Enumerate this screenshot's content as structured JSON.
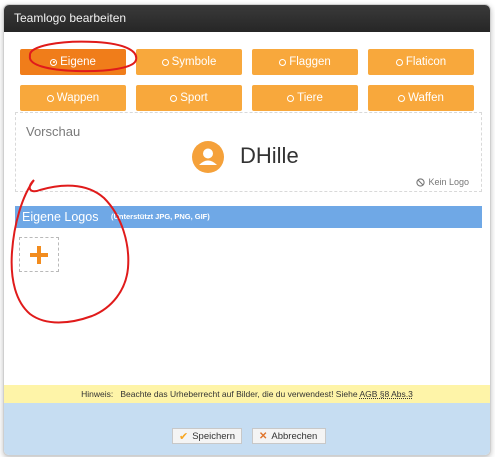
{
  "dialog": {
    "title": "Teamlogo bearbeiten"
  },
  "categories": [
    {
      "label": "Eigene",
      "selected": true
    },
    {
      "label": "Symbole",
      "selected": false
    },
    {
      "label": "Flaggen",
      "selected": false
    },
    {
      "label": "Flaticon",
      "selected": false
    },
    {
      "label": "Wappen",
      "selected": false
    },
    {
      "label": "Sport",
      "selected": false
    },
    {
      "label": "Tiere",
      "selected": false
    },
    {
      "label": "Waffen",
      "selected": false
    }
  ],
  "preview": {
    "label": "Vorschau",
    "team_name": "DHille",
    "no_logo_label": "Kein Logo"
  },
  "own_logos": {
    "title": "Eigene Logos",
    "hint": "(Unterstützt JPG, PNG, GIF)",
    "add_icon": "plus-icon"
  },
  "notice": {
    "prefix": "Hinweis:",
    "text": "Beachte das Urheberrecht auf Bilder, die du verwendest! Siehe",
    "link": "AGB §8 Abs.3"
  },
  "footer": {
    "save_label": "Speichern",
    "cancel_label": "Abbrechen"
  },
  "colors": {
    "accent": "#f8a83c",
    "accent_active": "#f07d1a",
    "section_bar": "#6fa8e6",
    "notice_bg": "#fef4a8",
    "footer_bg": "#c6ddf2",
    "annotation": "#e01b1b"
  }
}
